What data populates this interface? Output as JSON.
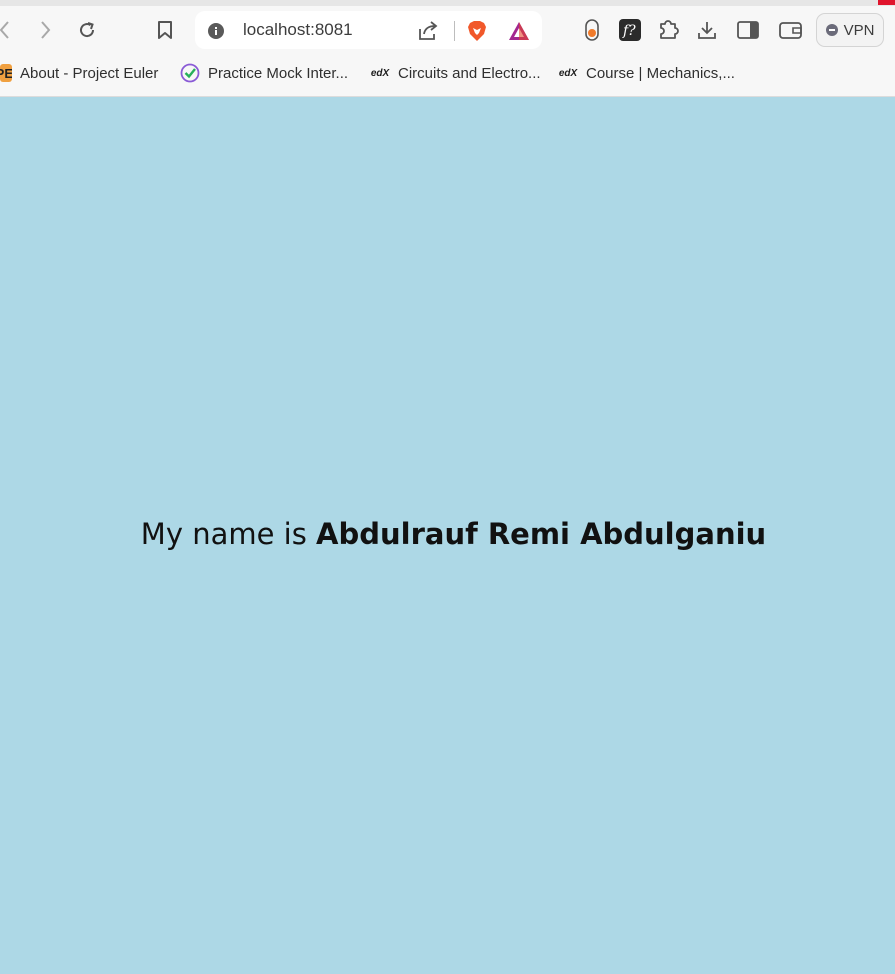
{
  "browser": {
    "address_bar": {
      "url": "localhost:8081"
    },
    "vpn_label": "VPN",
    "accent_color": "#e0142c"
  },
  "bookmarks": [
    {
      "label": "About - Project Euler",
      "favicon": "project-euler-icon",
      "favicon_text": "PE"
    },
    {
      "label": "Practice Mock Inter...",
      "favicon": "check-circle-icon"
    },
    {
      "label": "Circuits and Electro...",
      "favicon": "edx-icon",
      "favicon_text": "edX"
    },
    {
      "label": "Course | Mechanics,...",
      "favicon": "edx-icon",
      "favicon_text": "edX"
    }
  ],
  "page": {
    "background": "#add8e6",
    "greeting_prefix": "My name is ",
    "name": "Abdulrauf Remi Abdulganiu"
  }
}
